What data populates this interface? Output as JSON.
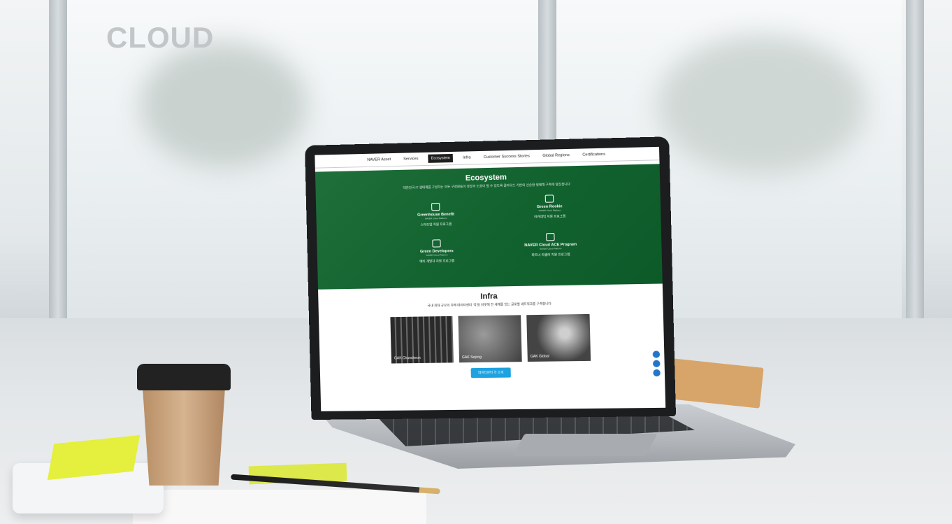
{
  "brand": {
    "logo_text": "CLOUD"
  },
  "colors": {
    "eco_green": "#12632f",
    "accent_blue": "#1ea2e0",
    "logo_grey": "#c3c6c8"
  },
  "site": {
    "nav": [
      "NAVER Asset",
      "Services",
      "Ecosystem",
      "Infra",
      "Customer Success Stories",
      "Global Regions",
      "Certifications"
    ],
    "active_nav": "Ecosystem",
    "ecosystem": {
      "title": "Ecosystem",
      "subtitle": "대한민국 IT 생태계를 구성하는 모든 구성원들이 성장의 도움이 될 수 있도록 클라우드 기반의 선순환 생태계 구축에 앞장섭니다",
      "programs": [
        {
          "name": "Greenhouse Benefit",
          "sub": "NAVER Cloud Platform",
          "desc": "스타트업 지원 프로그램"
        },
        {
          "name": "Green Rookie",
          "sub": "NAVER Cloud Platform",
          "desc": "아카데믹 지원 프로그램"
        },
        {
          "name": "Green Developers",
          "sub": "NAVER Cloud Platform",
          "desc": "예비 개발자 지원 프로그램"
        },
        {
          "name": "NAVER Cloud ACE Program",
          "sub": "NAVER Cloud Platform",
          "desc": "파트너 리셀러 지원 프로그램"
        }
      ]
    },
    "infra": {
      "title": "Infra",
      "subtitle": "국내 최대 규모의 자체 데이터센터 '각'을 비롯해 전 세계를 잇는 글로벌 네트워크를 구축합니다",
      "datacenters": [
        "GAK Chuncheon",
        "GAK Sejong",
        "GAK Global"
      ],
      "button": "데이터센터 각 소개"
    }
  }
}
